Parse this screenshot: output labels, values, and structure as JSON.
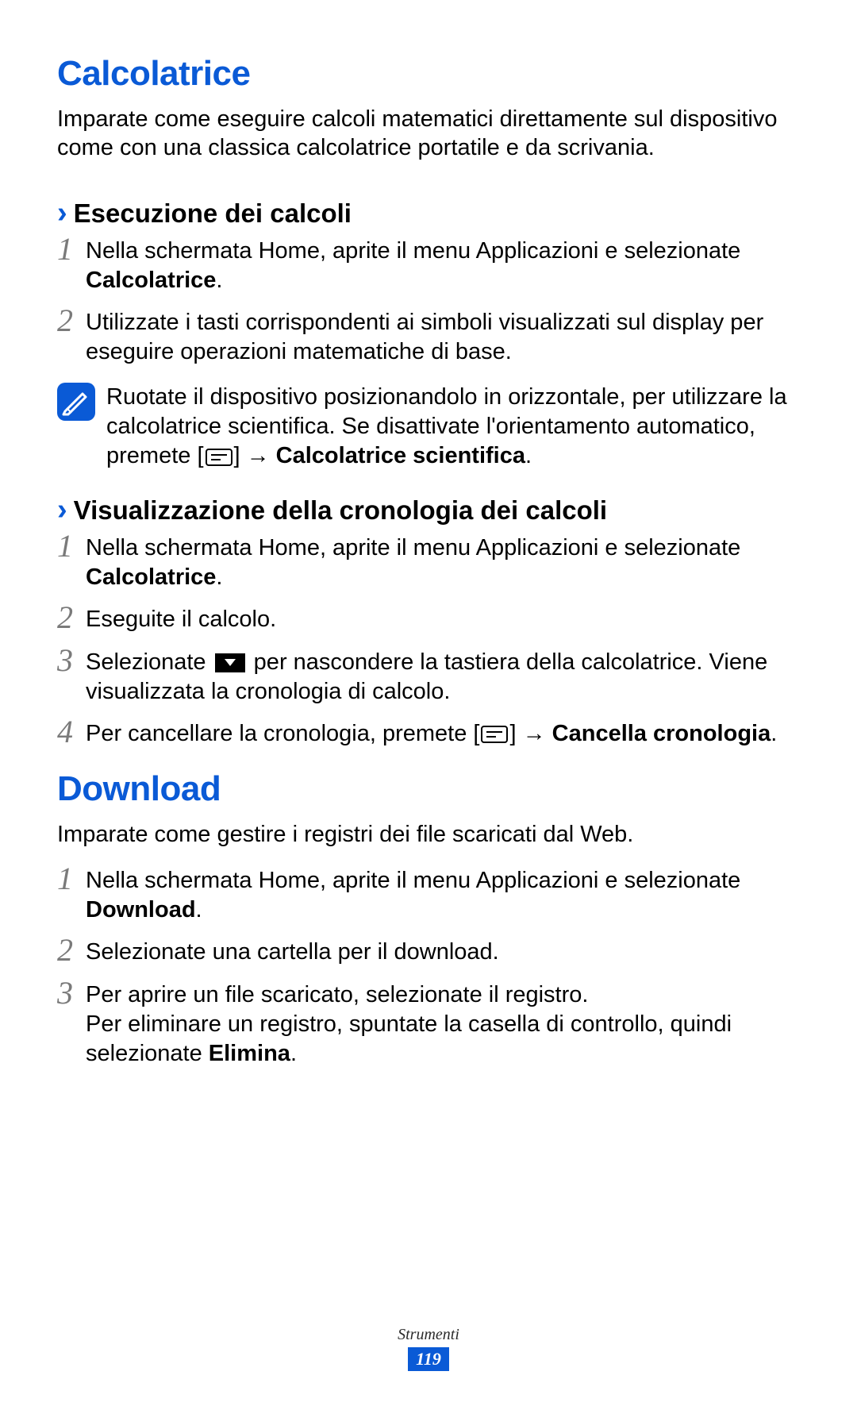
{
  "section1": {
    "title": "Calcolatrice",
    "intro": "Imparate come eseguire calcoli matematici direttamente sul dispositivo come con una classica calcolatrice portatile e da scrivania.",
    "sub1": {
      "title": "Esecuzione dei calcoli",
      "step1_a": "Nella schermata Home, aprite il menu Applicazioni e selezionate ",
      "step1_b": "Calcolatrice",
      "step1_c": ".",
      "step2": "Utilizzate i tasti corrispondenti ai simboli visualizzati sul display per eseguire operazioni matematiche di base.",
      "note_a": "Ruotate il dispositivo posizionandolo in orizzontale, per utilizzare la calcolatrice scientifica. Se disattivate l'orientamento automatico, premete [",
      "note_b": "] → ",
      "note_c": "Calcolatrice scientifica",
      "note_d": "."
    },
    "sub2": {
      "title": "Visualizzazione della cronologia dei calcoli",
      "step1_a": "Nella schermata Home, aprite il menu Applicazioni e selezionate ",
      "step1_b": "Calcolatrice",
      "step1_c": ".",
      "step2": "Eseguite il calcolo.",
      "step3_a": "Selezionate ",
      "step3_b": " per nascondere la tastiera della calcolatrice. Viene visualizzata la cronologia di calcolo.",
      "step4_a": "Per cancellare la cronologia, premete [",
      "step4_b": "] → ",
      "step4_c": "Cancella cronologia",
      "step4_d": "."
    }
  },
  "section2": {
    "title": "Download",
    "intro": "Imparate come gestire i registri dei file scaricati dal Web.",
    "step1_a": "Nella schermata Home, aprite il menu Applicazioni e selezionate ",
    "step1_b": "Download",
    "step1_c": ".",
    "step2": "Selezionate una cartella per il download.",
    "step3_a": "Per aprire un file scaricato, selezionate il registro.",
    "step3_b": "Per eliminare un registro, spuntate la casella di controllo, quindi selezionate ",
    "step3_c": "Elimina",
    "step3_d": "."
  },
  "footer": {
    "chapter": "Strumenti",
    "page": "119"
  },
  "nums": {
    "n1": "1",
    "n2": "2",
    "n3": "3",
    "n4": "4"
  },
  "chevron": "›"
}
